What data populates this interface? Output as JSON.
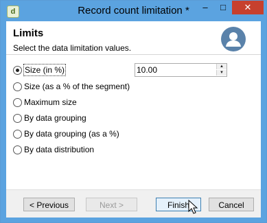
{
  "window": {
    "title": "Record count limitation *",
    "minimize_glyph": "–",
    "maximize_glyph": "□",
    "close_glyph": "✕",
    "app_icon_glyph": "d"
  },
  "header": {
    "title": "Limits",
    "subtitle": "Select the data limitation values.",
    "icon": "user-avatar-icon"
  },
  "options": [
    {
      "label": "Size (in %)",
      "checked": true
    },
    {
      "label": "Size (as a % of the segment)",
      "checked": false
    },
    {
      "label": "Maximum size",
      "checked": false
    },
    {
      "label": "By data grouping",
      "checked": false
    },
    {
      "label": "By data grouping (as a %)",
      "checked": false
    },
    {
      "label": "By data distribution",
      "checked": false
    }
  ],
  "size_value": "10.00",
  "buttons": {
    "previous_label": "< Previous",
    "next_label": "Next >",
    "finish_label": "Finish",
    "cancel_label": "Cancel"
  },
  "colors": {
    "titlebar": "#5ba3e0",
    "close_button": "#c7402d",
    "avatar": "#5a82aa"
  }
}
